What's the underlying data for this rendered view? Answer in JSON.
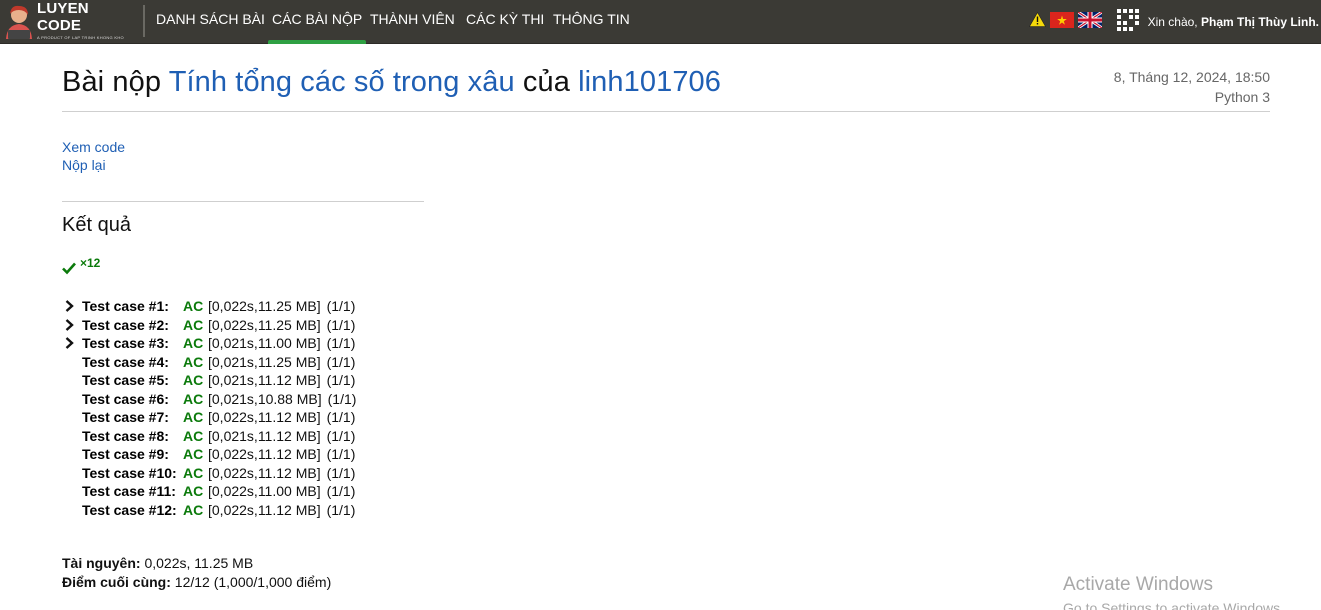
{
  "navbar": {
    "logo_title": "LUYEN CODE",
    "logo_subtitle": "A PRODUCT OF LAP TRINH KHONG KHO",
    "items": [
      {
        "label": "DANH SÁCH BÀI",
        "active": false
      },
      {
        "label": "CÁC BÀI NỘP",
        "active": true
      },
      {
        "label": "THÀNH VIÊN",
        "active": false
      },
      {
        "label": "CÁC KỲ THI",
        "active": false
      },
      {
        "label": "THÔNG TIN",
        "active": false
      }
    ],
    "greeting": "Xin chào,",
    "username": "Phạm Thị Thùy Linh.",
    "icons": [
      "warning-icon",
      "vietnam-flag-icon",
      "uk-flag-icon",
      "user-avatar-icon"
    ],
    "accent_color": "#2ea043"
  },
  "header": {
    "title_prefix": "Bài nộp",
    "problem_name": "Tính tổng các số trong xâu",
    "title_of": "của",
    "user": "linh101706",
    "date": "8, Tháng 12, 2024, 18:50",
    "language": "Python 3"
  },
  "links": {
    "view_code": "Xem code",
    "resubmit": "Nộp lại"
  },
  "results": {
    "heading": "Kết quả",
    "check_count": "×12",
    "cases": [
      {
        "label": "Test case #1:",
        "status": "AC",
        "detail": "[0,022s,11.25 MB]",
        "points": "(1/1)",
        "expandable": true
      },
      {
        "label": "Test case #2:",
        "status": "AC",
        "detail": "[0,022s,11.25 MB]",
        "points": "(1/1)",
        "expandable": true
      },
      {
        "label": "Test case #3:",
        "status": "AC",
        "detail": "[0,021s,11.00 MB]",
        "points": "(1/1)",
        "expandable": true
      },
      {
        "label": "Test case #4:",
        "status": "AC",
        "detail": "[0,021s,11.25 MB]",
        "points": "(1/1)",
        "expandable": false
      },
      {
        "label": "Test case #5:",
        "status": "AC",
        "detail": "[0,021s,11.12 MB]",
        "points": "(1/1)",
        "expandable": false
      },
      {
        "label": "Test case #6:",
        "status": "AC",
        "detail": "[0,021s,10.88 MB]",
        "points": "(1/1)",
        "expandable": false
      },
      {
        "label": "Test case #7:",
        "status": "AC",
        "detail": "[0,022s,11.12 MB]",
        "points": "(1/1)",
        "expandable": false
      },
      {
        "label": "Test case #8:",
        "status": "AC",
        "detail": "[0,021s,11.12 MB]",
        "points": "(1/1)",
        "expandable": false
      },
      {
        "label": "Test case #9:",
        "status": "AC",
        "detail": "[0,022s,11.12 MB]",
        "points": "(1/1)",
        "expandable": false
      },
      {
        "label": "Test case #10:",
        "status": "AC",
        "detail": "[0,022s,11.12 MB]",
        "points": "(1/1)",
        "expandable": false
      },
      {
        "label": "Test case #11:",
        "status": "AC",
        "detail": "[0,022s,11.00 MB]",
        "points": "(1/1)",
        "expandable": false
      },
      {
        "label": "Test case #12:",
        "status": "AC",
        "detail": "[0,022s,11.12 MB]",
        "points": "(1/1)",
        "expandable": false
      }
    ]
  },
  "summary": {
    "resources_label": "Tài nguyên:",
    "resources_value": "0,022s, 11.25 MB",
    "final_score_label": "Điểm cuối cùng:",
    "final_score_value": "12/12 (1,000/1,000 điểm)"
  },
  "watermark": {
    "line1": "Activate Windows",
    "line2": "Go to Settings to activate Windows."
  }
}
